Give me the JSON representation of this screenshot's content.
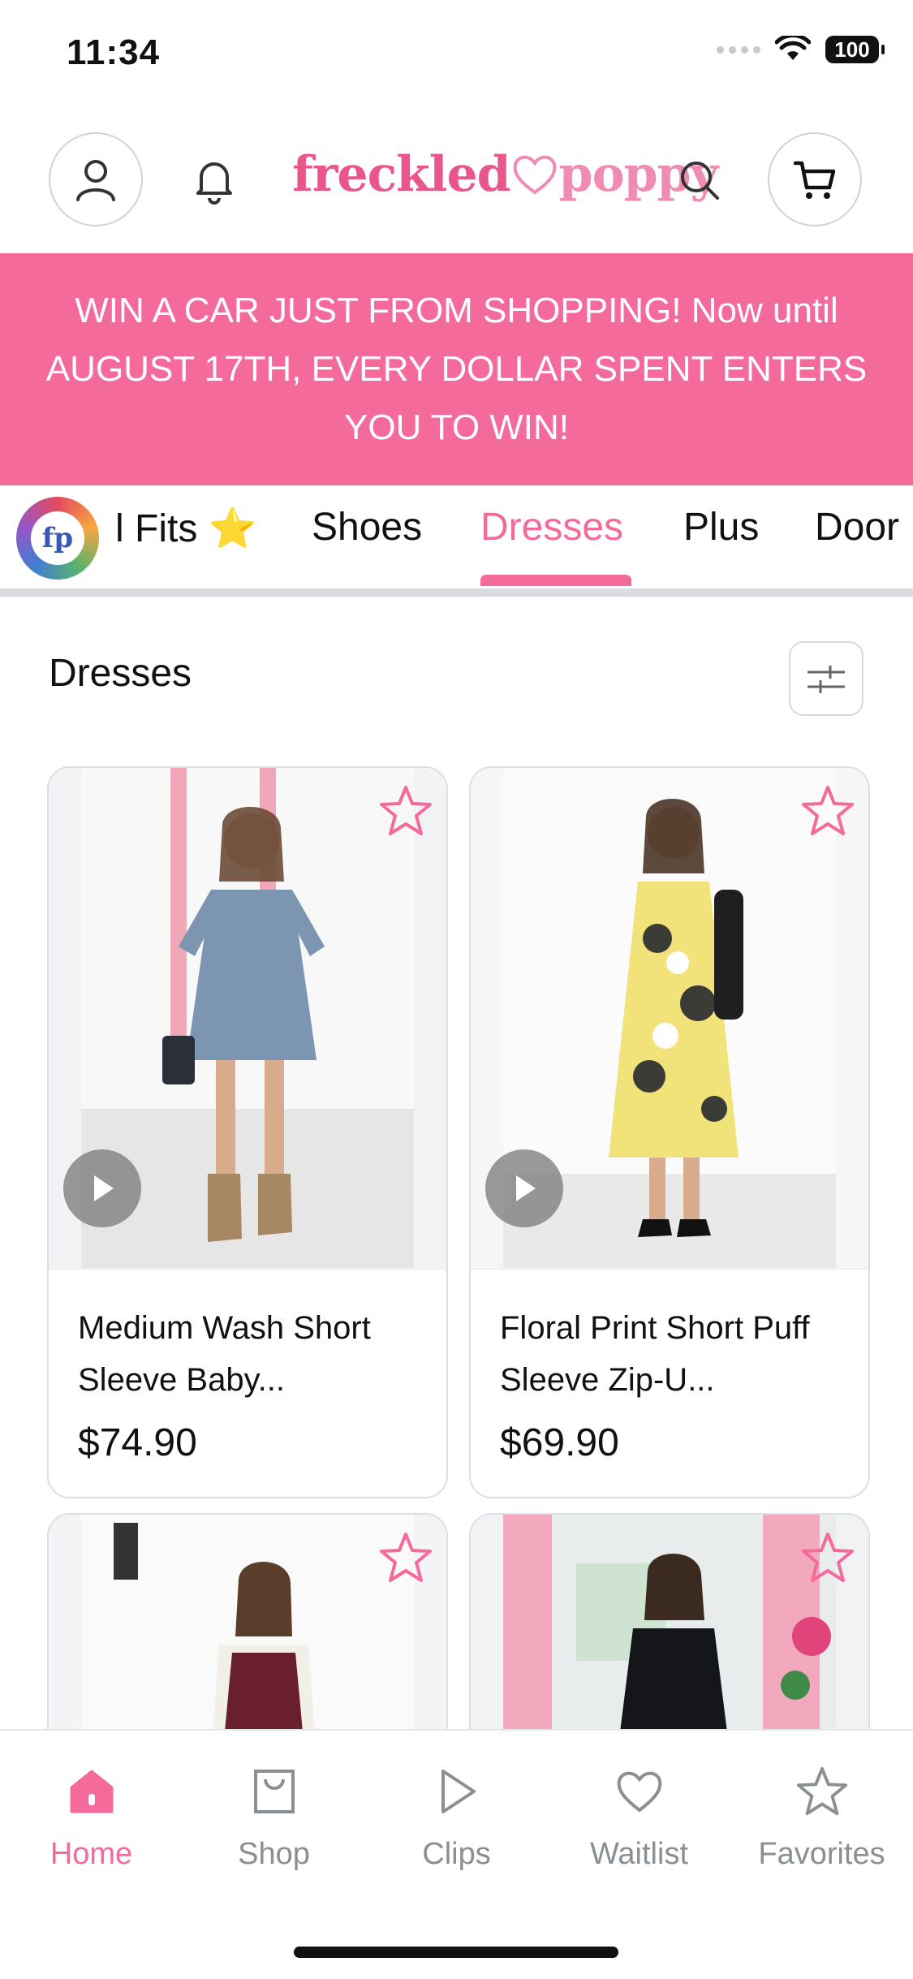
{
  "status_bar": {
    "time": "11:34",
    "battery": "100"
  },
  "header": {
    "logo_part1": "freckled",
    "logo_part2": "poppy"
  },
  "banner": {
    "text": "WIN A CAR JUST FROM SHOPPING! Now until AUGUST 17TH, EVERY DOLLAR SPENT ENTERS YOU TO WIN!"
  },
  "category_tabs": {
    "avatar_text": "fp",
    "items": [
      {
        "label": "l Fits ⭐"
      },
      {
        "label": "Shoes"
      },
      {
        "label": "Dresses"
      },
      {
        "label": "Plus"
      },
      {
        "label": "Door"
      }
    ],
    "active": "Dresses"
  },
  "section": {
    "title": "Dresses"
  },
  "products": [
    {
      "name": "Medium Wash Short Sleeve Baby...",
      "price": "$74.90"
    },
    {
      "name": "Floral Print Short Puff Sleeve Zip-U...",
      "price": "$69.90"
    }
  ],
  "bottom_nav": {
    "items": [
      {
        "label": "Home",
        "icon": "home-icon"
      },
      {
        "label": "Shop",
        "icon": "shopping-bag-icon"
      },
      {
        "label": "Clips",
        "icon": "play-icon"
      },
      {
        "label": "Waitlist",
        "icon": "heart-icon"
      },
      {
        "label": "Favorites",
        "icon": "star-icon"
      }
    ],
    "active": "Home"
  },
  "colors": {
    "accent": "#f46a9b",
    "banner": "#f46a9b",
    "inactive": "#8a8f94"
  }
}
